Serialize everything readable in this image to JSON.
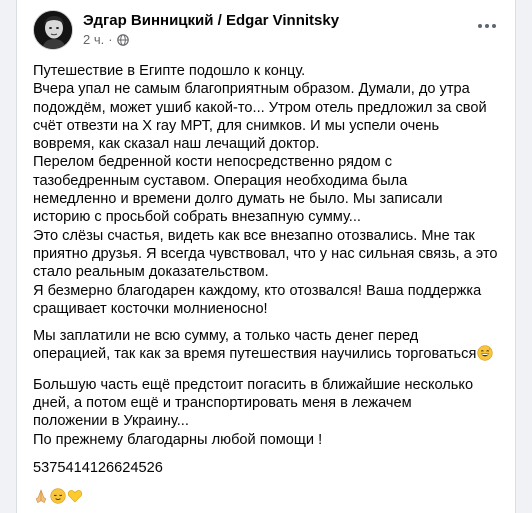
{
  "post": {
    "author": "Эдгар Винницкий / Edgar Vinnitsky",
    "time": "2 ч.",
    "separator": "·",
    "icons": {
      "avatar": "profile-photo",
      "audience": "globe-icon",
      "menu": "more-options-icon"
    }
  },
  "content": {
    "p1": [
      "Путешествие в Египте подошло к концу.",
      "Вчера упал не самым благоприятным образом. Думали, до утра",
      "подождём, может ушиб какой-то... Утром отель предложил за свой",
      "счёт отвезти на X ray МРТ, для снимков. И мы успели очень",
      "вовремя, как сказал наш лечащий доктор.",
      "Перелом бедренной кости непосредственно рядом с",
      "тазобедренным суставом. Операция необходима была",
      "немедленно и времени долго думать не было. Мы записали",
      "историю с просьбой собрать внезапную сумму...",
      "Это слёзы счастья, видеть как все внезапно отозвались. Мне так",
      "приятно друзья. Я всегда чувствовал, что у нас сильная связь, а это",
      "стало реальным доказательством.",
      "Я безмерно благодарен каждому, кто отозвался! Ваша поддержка",
      "сращивает косточки молниеносно!"
    ],
    "p2": [
      "Мы заплатили не всю сумму, а только часть денег перед",
      "операцией, так как за время путешествия научились торговаться"
    ],
    "p3": [
      "Большую часть ещё предстоит погасить в ближайшие несколько",
      "дней, а потом ещё и транспортировать меня в лежачем",
      "положении в Украину...",
      "По прежнему благодарны любой помощи !"
    ],
    "card_number": "5375414126624526",
    "emoji_inline": "grinning-sweat-emoji",
    "emoji_end": [
      "folded-hands-emoji",
      "relieved-face-emoji",
      "yellow-heart-emoji"
    ]
  }
}
